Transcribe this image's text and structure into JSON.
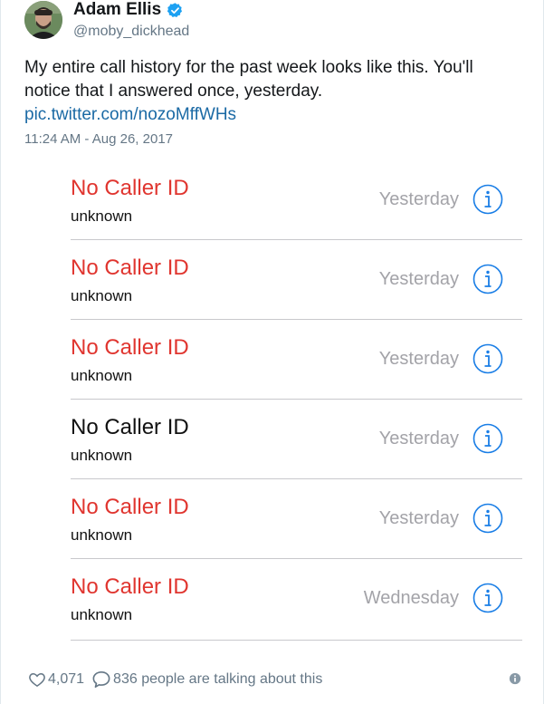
{
  "tweet": {
    "author": {
      "display_name": "Adam Ellis",
      "handle": "@moby_dickhead",
      "verified": true
    },
    "text": "My entire call history for the past week looks like this. You'll notice that I answered once, yesterday.",
    "link": "pic.twitter.com/nozoMffWHs",
    "timestamp": "11:24 AM - Aug 26, 2017"
  },
  "call_history": [
    {
      "caller": "No Caller ID",
      "subtitle": "unknown",
      "date": "Yesterday",
      "missed": true
    },
    {
      "caller": "No Caller ID",
      "subtitle": "unknown",
      "date": "Yesterday",
      "missed": true
    },
    {
      "caller": "No Caller ID",
      "subtitle": "unknown",
      "date": "Yesterday",
      "missed": true
    },
    {
      "caller": "No Caller ID",
      "subtitle": "unknown",
      "date": "Yesterday",
      "missed": false
    },
    {
      "caller": "No Caller ID",
      "subtitle": "unknown",
      "date": "Yesterday",
      "missed": true
    },
    {
      "caller": "No Caller ID",
      "subtitle": "unknown",
      "date": "Wednesday",
      "missed": true
    }
  ],
  "footer": {
    "likes": "4,071",
    "talking": "836 people are talking about this"
  },
  "colors": {
    "missed_call": "#e0352f",
    "answered_call": "#111111",
    "info_icon": "#1a7ee6",
    "link": "#1b6aa5",
    "verified_badge": "#1da1f2"
  },
  "icons": {
    "verified": "verified-badge-icon",
    "info": "info-circle-icon",
    "like": "heart-icon",
    "reply": "speech-bubble-icon",
    "footer_info": "info-icon"
  }
}
